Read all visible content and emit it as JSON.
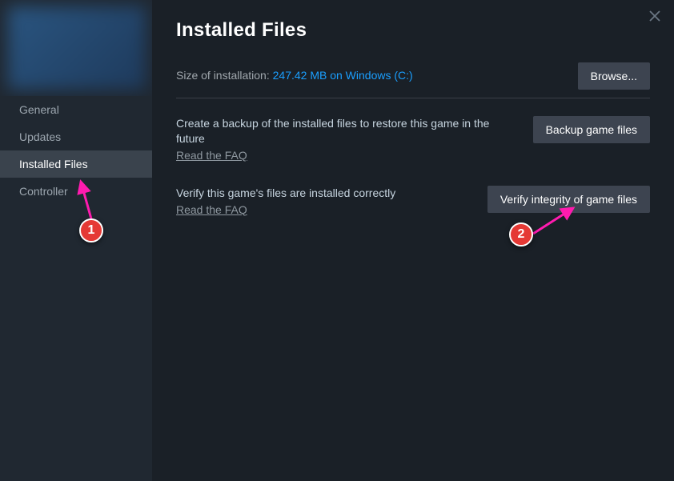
{
  "page": {
    "title": "Installed Files"
  },
  "sidebar": {
    "items": [
      {
        "label": "General"
      },
      {
        "label": "Updates"
      },
      {
        "label": "Installed Files"
      },
      {
        "label": "Controller"
      }
    ]
  },
  "installation": {
    "size_label": "Size of installation: ",
    "size_value": "247.42 MB on Windows (C:)",
    "browse_label": "Browse..."
  },
  "backup": {
    "description": "Create a backup of the installed files to restore this game in the future",
    "faq_label": "Read the FAQ",
    "button_label": "Backup game files"
  },
  "verify": {
    "description": "Verify this game's files are installed correctly",
    "faq_label": "Read the FAQ",
    "button_label": "Verify integrity of game files"
  },
  "annotations": {
    "marker1": "1",
    "marker2": "2"
  }
}
